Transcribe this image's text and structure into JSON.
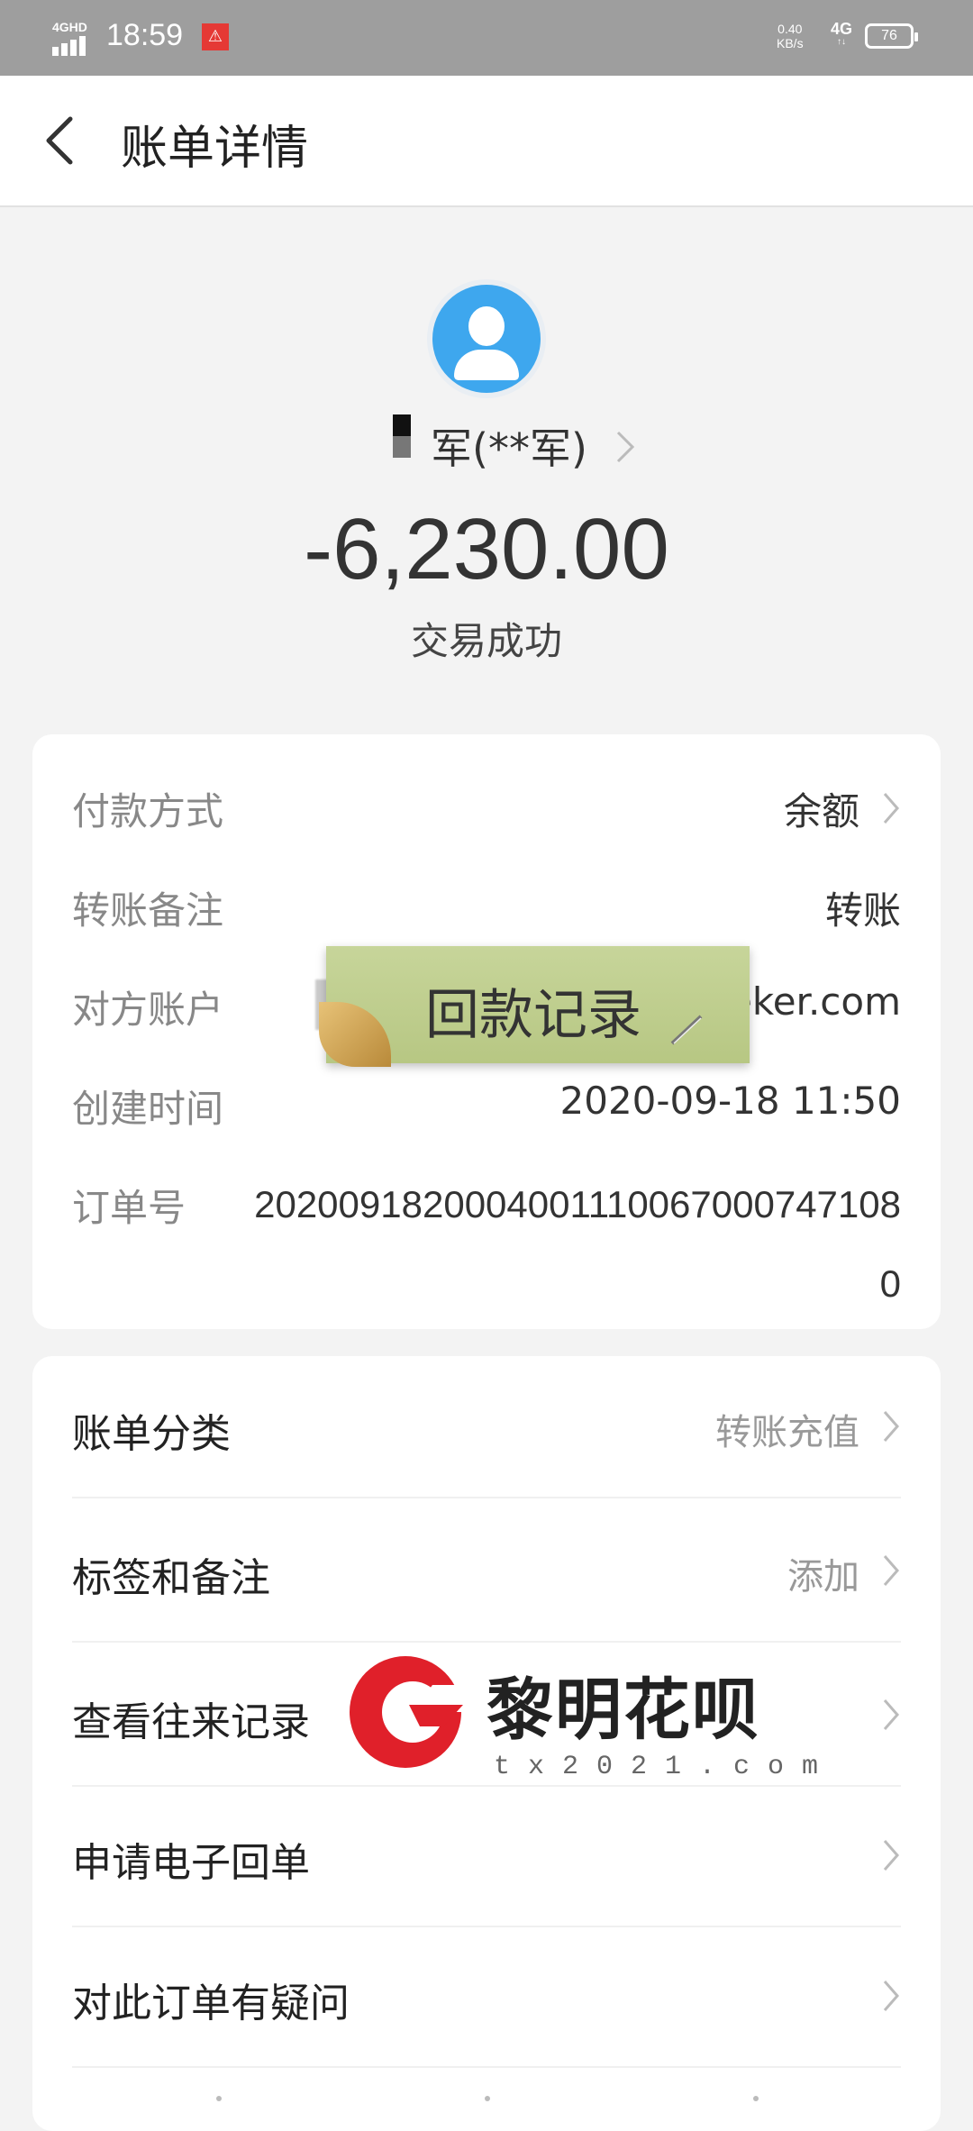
{
  "status_bar": {
    "network_type": "4GHD",
    "time": "18:59",
    "speed_value": "0.40",
    "speed_unit": "KB/s",
    "network_4g": "4G",
    "battery": "76"
  },
  "header": {
    "title": "账单详情"
  },
  "payee": {
    "name": "军(**军)"
  },
  "summary": {
    "amount": "-6,230.00",
    "status": "交易成功"
  },
  "details": [
    {
      "label": "付款方式",
      "value": "余额"
    },
    {
      "label": "转账备注",
      "value": "转账"
    },
    {
      "label": "对方账户",
      "value": "eker.com"
    },
    {
      "label": "创建时间",
      "value": "2020-09-18 11:50"
    },
    {
      "label": "订单号",
      "value": "20200918200040011100670007471080"
    }
  ],
  "sticker": {
    "text": "回款记录"
  },
  "actions": [
    {
      "label": "账单分类",
      "value": "转账充值"
    },
    {
      "label": "标签和备注",
      "value": "添加"
    },
    {
      "label": "查看往来记录",
      "value": ""
    },
    {
      "label": "申请电子回单",
      "value": ""
    },
    {
      "label": "对此订单有疑问",
      "value": ""
    }
  ],
  "watermark": {
    "title": "黎明花呗",
    "url": "tx2021.com"
  },
  "colors": {
    "avatar_blue": "#3ea7ee",
    "status_bar": "#9e9e9e",
    "logo_red": "#e0202a"
  }
}
